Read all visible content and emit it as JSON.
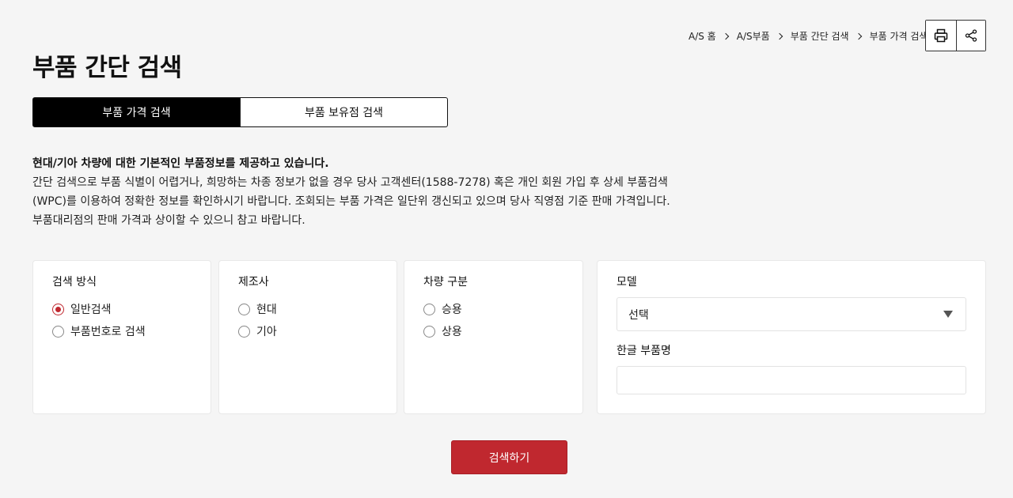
{
  "breadcrumb": {
    "items": [
      "A/S 홈",
      "A/S부품",
      "부품 간단 검색",
      "부품 가격 검색"
    ]
  },
  "toolbar": {
    "print_icon": "printer-icon",
    "share_icon": "share-icon"
  },
  "page": {
    "title": "부품 간단 검색"
  },
  "tabs": [
    {
      "label": "부품 가격 검색",
      "active": true
    },
    {
      "label": "부품 보유점 검색",
      "active": false
    }
  ],
  "intro": {
    "lead": "현대/기아 차량에 대한 기본적인 부품정보를 제공하고 있습니다.",
    "line1": "간단 검색으로 부품 식별이 어렵거나, 희망하는 차종 정보가 없을 경우 당사 고객센터(1588-7278) 혹은 개인 회원 가입 후 상세 부품검색",
    "line2": "(WPC)를 이용하여 정확한 정보를 확인하시기 바랍니다. 조회되는 부품 가격은 일단위 갱신되고 있으며 당사 직영점 기준 판매 가격입니다.",
    "line3": "부품대리점의 판매 가격과 상이할 수 있으니 참고 바랍니다."
  },
  "filters": {
    "method": {
      "title": "검색 방식",
      "options": [
        {
          "label": "일반검색",
          "checked": true
        },
        {
          "label": "부품번호로 검색",
          "checked": false
        }
      ]
    },
    "maker": {
      "title": "제조사",
      "options": [
        {
          "label": "현대",
          "checked": false
        },
        {
          "label": "기아",
          "checked": false
        }
      ]
    },
    "vehicle": {
      "title": "차량 구분",
      "options": [
        {
          "label": "승용",
          "checked": false
        },
        {
          "label": "상용",
          "checked": false
        }
      ]
    },
    "model": {
      "title": "모델",
      "selected": "선택",
      "part_name_label": "한글 부품명",
      "part_name_value": "",
      "part_name_placeholder": ""
    }
  },
  "actions": {
    "search_label": "검색하기"
  },
  "colors": {
    "accent": "#c0282f",
    "tab_active_bg": "#000000",
    "page_bg": "#f5f5f5"
  }
}
